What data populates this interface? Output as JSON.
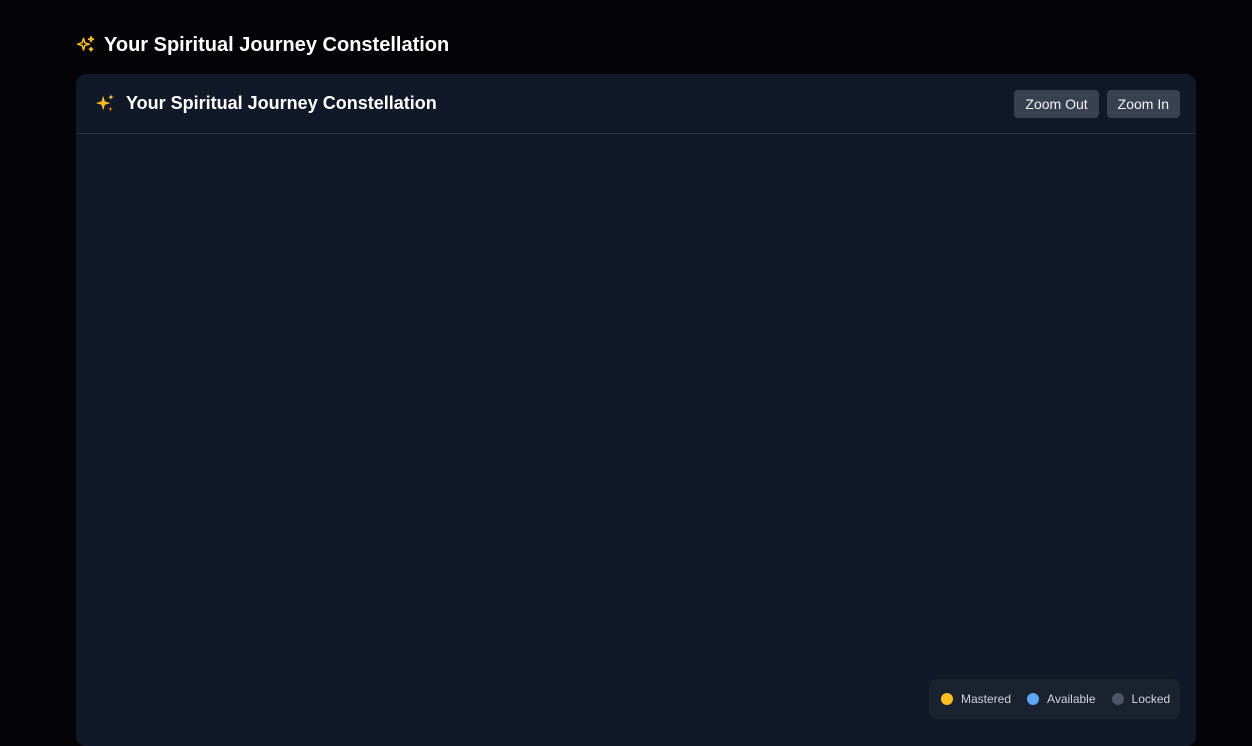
{
  "page": {
    "heading": "Your Spiritual Journey Constellation",
    "heading_icon": "sparkles-outline-icon"
  },
  "panel": {
    "title": "Your Spiritual Journey Constellation",
    "title_icon": "sparkles-emoji-icon",
    "zoom_out_label": "Zoom Out",
    "zoom_in_label": "Zoom In"
  },
  "legend": {
    "items": [
      {
        "label": "Mastered",
        "color": "#fbbf24"
      },
      {
        "label": "Available",
        "color": "#60a5fa"
      },
      {
        "label": "Locked",
        "color": "#4b5563"
      }
    ]
  },
  "colors": {
    "background": "#030308",
    "panel": "#111827",
    "accent_gold": "#fbbf24"
  }
}
